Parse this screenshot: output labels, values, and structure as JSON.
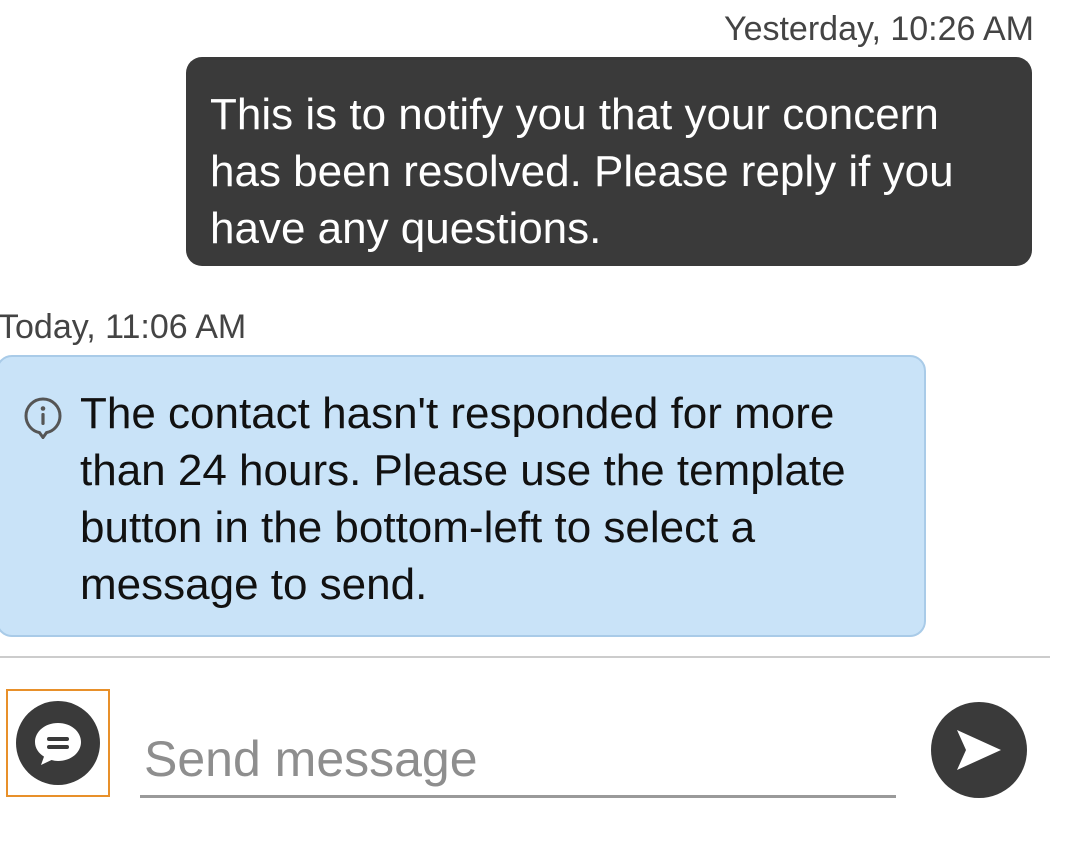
{
  "conversation": {
    "outgoing_message": {
      "timestamp": "Yesterday, 10:26 AM",
      "text": "This is to notify you that your concern has been resolved. Please reply if you have any questions."
    },
    "system_notice": {
      "timestamp": "Today, 11:06 AM",
      "icon": "info-icon",
      "text": "The contact hasn't responded for more than 24 hours. Please use the template button in the bottom-left to select a message to send."
    }
  },
  "composer": {
    "template_button_icon": "chat-bubble-icon",
    "input_placeholder": "Send message",
    "input_value": "",
    "send_button_icon": "send-arrow-icon"
  },
  "colors": {
    "outgoing_bubble": "#3a3a3a",
    "notice_background": "#c9e3f8",
    "template_focus_border": "#e8902a",
    "send_button": "#3a3a3a"
  }
}
